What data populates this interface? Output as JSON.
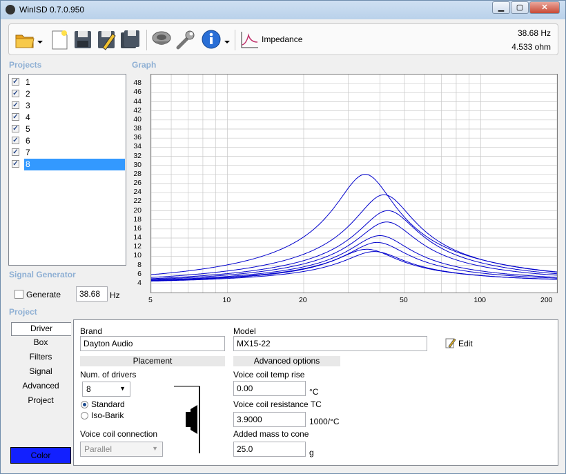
{
  "window": {
    "title": "WinISD 0.7.0.950",
    "minimize": "▁",
    "maximize": "▢",
    "close": "✕"
  },
  "toolbar": {
    "view_label": "Impedance",
    "readout_freq": "38.68 Hz",
    "readout_value": "4.533 ohm"
  },
  "sections": {
    "projects": "Projects",
    "graph": "Graph",
    "signal_generator": "Signal Generator",
    "project": "Project"
  },
  "projects": [
    {
      "label": "1",
      "checked": true
    },
    {
      "label": "2",
      "checked": true
    },
    {
      "label": "3",
      "checked": true
    },
    {
      "label": "4",
      "checked": true
    },
    {
      "label": "5",
      "checked": true
    },
    {
      "label": "6",
      "checked": true
    },
    {
      "label": "7",
      "checked": true
    },
    {
      "label": "8",
      "checked": true,
      "selected": true
    }
  ],
  "chart_data": {
    "type": "line",
    "xscale": "log",
    "xlim": [
      5,
      200
    ],
    "ylim": [
      2,
      50
    ],
    "y_ticks": [
      "48",
      "46",
      "44",
      "42",
      "40",
      "38",
      "36",
      "34",
      "32",
      "30",
      "28",
      "26",
      "24",
      "22",
      "20",
      "18",
      "16",
      "14",
      "12",
      "10",
      "8",
      "6",
      "4"
    ],
    "x_ticks": [
      "5",
      "10",
      "20",
      "50",
      "100",
      "200"
    ],
    "grid": true,
    "series_color": "#0000cc",
    "series": [
      {
        "fs": 35.0,
        "zmax": 28.0
      },
      {
        "fs": 41.5,
        "zmax": 23.5
      },
      {
        "fs": 43.0,
        "zmax": 20.0
      },
      {
        "fs": 42.5,
        "zmax": 17.5
      },
      {
        "fs": 40.0,
        "zmax": 14.5
      },
      {
        "fs": 39.0,
        "zmax": 13.0
      },
      {
        "fs": 35.5,
        "zmax": 11.5
      },
      {
        "fs": 38.0,
        "zmax": 11.0
      }
    ]
  },
  "signal_gen": {
    "generate_label": "Generate",
    "freq_value": "38.68",
    "unit": "Hz"
  },
  "tabs": [
    "Driver",
    "Box",
    "Filters",
    "Signal",
    "Advanced",
    "Project"
  ],
  "color_button": "Color",
  "driver": {
    "brand_label": "Brand",
    "brand_value": "Dayton Audio",
    "model_label": "Model",
    "model_value": "MX15-22",
    "edit_label": "Edit",
    "placement_header": "Placement",
    "num_drivers_label": "Num. of drivers",
    "num_drivers_value": "8",
    "standard_label": "Standard",
    "isobarik_label": "Iso-Barik",
    "vc_connection_label": "Voice coil connection",
    "vc_connection_value": "Parallel",
    "advanced_header": "Advanced options",
    "vc_temp_label": "Voice coil temp rise",
    "vc_temp_value": "0.00",
    "vc_temp_unit": "°C",
    "vc_res_label": "Voice coil resistance TC",
    "vc_res_value": "3.9000",
    "vc_res_unit": "1000/°C",
    "added_mass_label": "Added mass to cone",
    "added_mass_value": "25.0",
    "added_mass_unit": "g"
  }
}
